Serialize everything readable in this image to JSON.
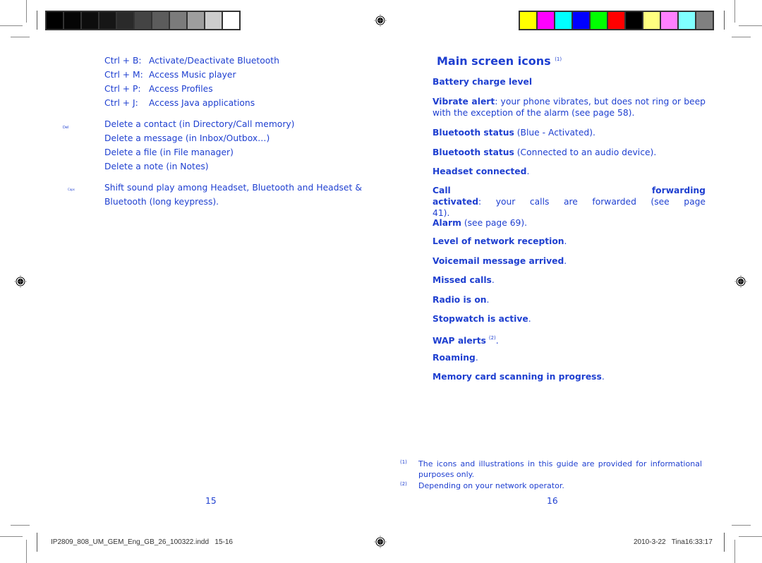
{
  "print_marks": {
    "gray_swatches": [
      "#000000",
      "#050505",
      "#0d0d0d",
      "#161616",
      "#2a2a2a",
      "#444444",
      "#5c5c5c",
      "#7b7b7b",
      "#9e9e9e",
      "#cccccc",
      "#ffffff"
    ],
    "color_swatches": [
      "#ffff00",
      "#ff00ff",
      "#00ffff",
      "#0000ff",
      "#00ff00",
      "#ff0000",
      "#000000",
      "#ffff80",
      "#ff80ff",
      "#80ffff",
      "#808080"
    ]
  },
  "left_page": {
    "shortcuts": [
      {
        "key": "Ctrl + B:",
        "action": "Activate/Deactivate Bluetooth"
      },
      {
        "key": "Ctrl + M:",
        "action": "Access Music player"
      },
      {
        "key": "Ctrl + P:",
        "action": "Access Profiles"
      },
      {
        "key": "Ctrl + J:",
        "action": "Access Java applications"
      }
    ],
    "del_key_label": "Del",
    "delete_items": [
      "Delete a contact (in Directory/Call memory)",
      "Delete a message (in Inbox/Outbox…)",
      "Delete a file (in File manager)",
      "Delete a note (in Notes)"
    ],
    "caps_key_label": "Caps",
    "caps_text_line1": "Shift sound play among Headset, Bluetooth and Headset &",
    "caps_text_line2": "Bluetooth (long keypress).",
    "page_number": "15"
  },
  "right_page": {
    "title": "Main screen icons",
    "title_footnote": "(1)",
    "items": [
      {
        "bold": "Battery charge level",
        "rest": ""
      },
      {
        "bold": "Vibrate alert",
        "rest": ": your phone vibrates, but does not ring or beep",
        "rest2": "with the exception of the alarm (see page 58)."
      },
      {
        "bold": "Bluetooth status",
        "rest": " (Blue - Activated)."
      },
      {
        "bold": "Bluetooth status",
        "rest": " (Connected to an audio device)."
      },
      {
        "bold": "Headset connected",
        "rest": "."
      },
      {
        "bold": "Call forwarding activated",
        "rest": ": your calls are forwarded (see page",
        "rest2": "41)."
      },
      {
        "bold": "Alarm",
        "rest": " (see page 69)."
      },
      {
        "bold": "Level of network reception",
        "rest": "."
      },
      {
        "bold": "Voicemail message arrived",
        "rest": "."
      },
      {
        "bold": "Missed calls",
        "rest": "."
      },
      {
        "bold": "Radio is on",
        "rest": "."
      },
      {
        "bold": "Stopwatch is active",
        "rest": "."
      },
      {
        "bold": "WAP alerts",
        "sup": "(2)",
        "rest": "."
      },
      {
        "bold": "Roaming",
        "rest": "."
      },
      {
        "bold": "Memory card scanning in progress",
        "rest": "."
      }
    ],
    "footnotes": [
      {
        "mark": "(1)",
        "line1": "The icons and illustrations in this guide are provided for informational",
        "line2": "purposes only."
      },
      {
        "mark": "(2)",
        "line1": "Depending on your network operator."
      }
    ],
    "page_number": "16"
  },
  "slug": {
    "filename": "IP2809_808_UM_GEM_Eng_GB_26_100322.indd   15-16",
    "timestamp": "2010-3-22   Tina16:33:17"
  }
}
